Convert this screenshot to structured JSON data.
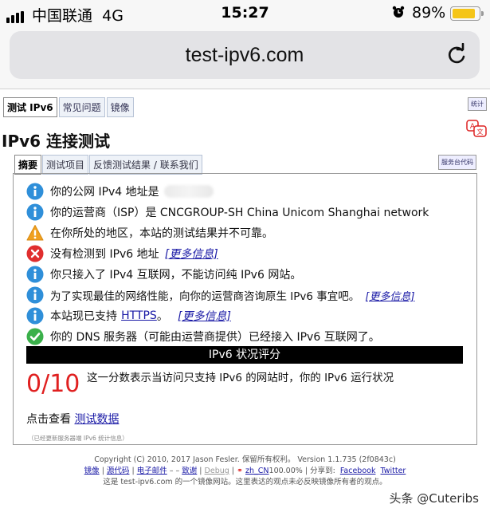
{
  "status_bar": {
    "carrier": "中国联通",
    "network": "4G",
    "time": "15:27",
    "battery": "89%",
    "battery_level": 0.89
  },
  "browser": {
    "url": "test-ipv6.com",
    "reload_icon": "reload-icon"
  },
  "top_nav": {
    "tabs": [
      "测试 IPv6",
      "常见问题",
      "镜像"
    ],
    "stats_label": "统计"
  },
  "page": {
    "title": "IPv6 连接测试",
    "sub_tabs": [
      "摘要",
      "测试项目",
      "反馈测试结果 / 联系我们"
    ],
    "service_code_label": "服务台代码"
  },
  "results": {
    "rows": [
      {
        "icon": "info",
        "text": "你的公网 IPv4 地址是"
      },
      {
        "icon": "info",
        "text": "你的运营商（ISP）是 CNCGROUP-SH China Unicom Shanghai network"
      },
      {
        "icon": "warning",
        "text": "在你所处的地区，本站的测试结果并不可靠。"
      },
      {
        "icon": "error",
        "text": "没有检测到 IPv6 地址",
        "more": "[更多信息]"
      },
      {
        "icon": "info",
        "text": "你只接入了 IPv4 互联网，不能访问纯 IPv6 网站。"
      },
      {
        "icon": "info",
        "text": "为了实现最佳的网络性能，向你的运营商咨询原生 IPv6 事宜吧。",
        "more": "[更多信息]"
      },
      {
        "icon": "info",
        "text": "本站现已支持",
        "link": "HTTPS",
        "after": "。",
        "more": "[更多信息]"
      },
      {
        "icon": "ok",
        "text": "你的 DNS 服务器（可能由运营商提供）已经接入 IPv6 互联网了。"
      }
    ],
    "score_header": "IPv6 状况评分",
    "score": "0/10",
    "score_desc": "这一分数表示当访问只支持 IPv6 的网站时，你的 IPv6 运行状况",
    "view_prefix": "点击查看",
    "view_link": "测试数据",
    "updated_note": "（已经更新服务器端 IPv6 统计信息）"
  },
  "footer": {
    "copyright": "Copyright (C) 2010, 2017 Jason Fesler. 保留所有权利。 Version 1.1.735 (2f0843c)",
    "links": [
      "镜像",
      "源代码",
      "电子邮件",
      "致谢",
      "Debug",
      "zh_CN",
      "Facebook",
      "Twitter"
    ],
    "progress": "100.00%",
    "share_label": "分享到:",
    "disclaimer": "这是 test-ipv6.com 的一个镜像网站。这里表达的观点未必反映镜像所有者的观点。"
  },
  "watermark": "头条 @Cuteribs",
  "colors": {
    "info": "#2f8fd9",
    "warning": "#f0a020",
    "error": "#e02e2e",
    "ok": "#3ab04a",
    "score": "#e02020",
    "battery": "#f5c518"
  }
}
